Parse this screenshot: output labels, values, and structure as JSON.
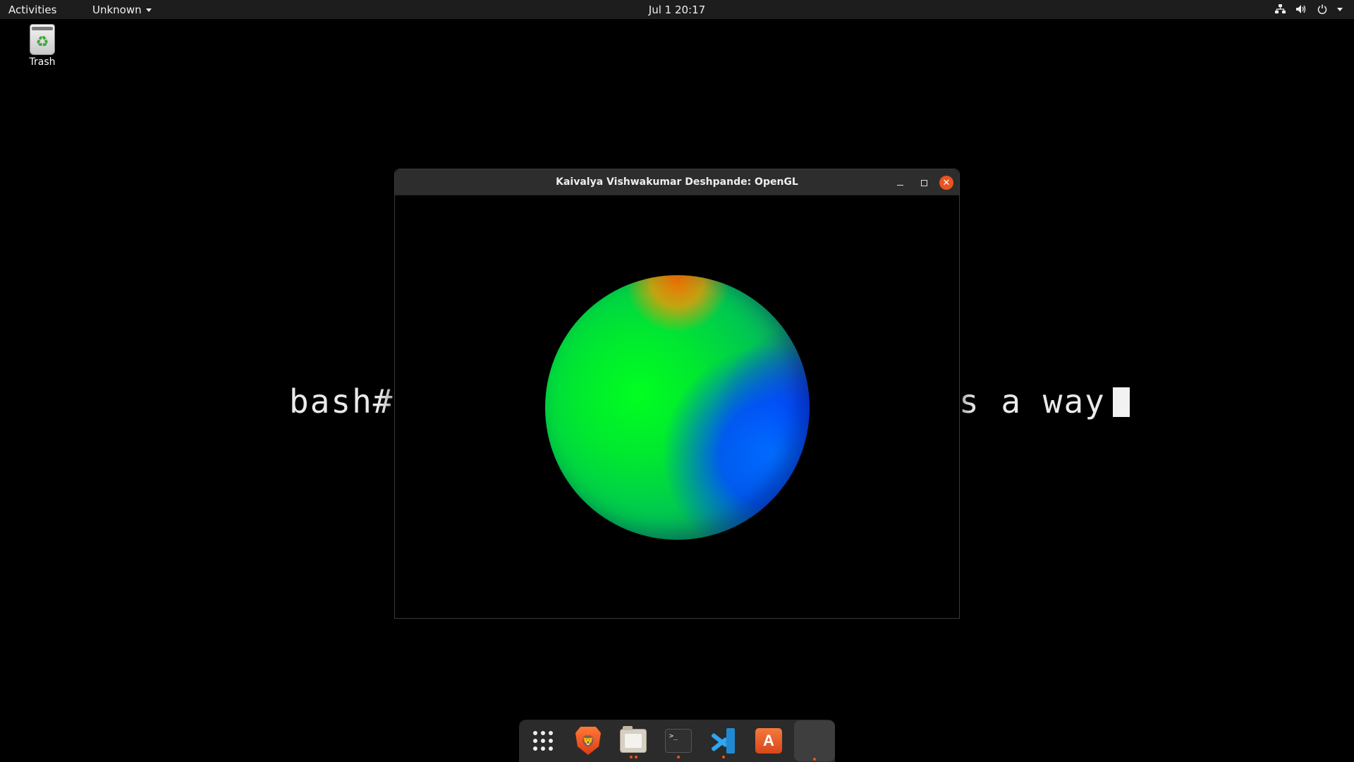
{
  "topbar": {
    "activities": "Activities",
    "app_menu": "Unknown",
    "clock": "Jul 1  20:17",
    "tray_icons": [
      "network-icon",
      "volume-icon",
      "power-icon",
      "chevron-down-icon"
    ]
  },
  "desktop": {
    "icons": [
      {
        "label": "Trash",
        "icon": "trash-icon"
      }
    ]
  },
  "terminal": {
    "left_text": "bash#",
    "right_text": "s a way"
  },
  "window": {
    "title": "Kaivalya Vishwakumar Deshpande: OpenGL",
    "controls": [
      "minimize-icon",
      "maximize-icon",
      "close-icon"
    ]
  },
  "dock": {
    "items": [
      {
        "name": "show-applications",
        "icon": "app-grid-icon",
        "running": 0
      },
      {
        "name": "brave-browser",
        "icon": "brave-icon",
        "running": 0
      },
      {
        "name": "files",
        "icon": "folder-icon",
        "running": 2
      },
      {
        "name": "terminal",
        "icon": "terminal-icon",
        "running": 1
      },
      {
        "name": "vscode",
        "icon": "vscode-icon",
        "running": 1
      },
      {
        "name": "software",
        "icon": "app-store-icon",
        "running": 0
      },
      {
        "name": "opengl-app",
        "icon": "blank-app-icon",
        "running": 1
      }
    ]
  },
  "colors": {
    "accent": "#e95420",
    "topbar_bg": "#1d1d1d",
    "dock_bg": "#2b2b2b",
    "titlebar_bg": "#2d2d2d"
  }
}
